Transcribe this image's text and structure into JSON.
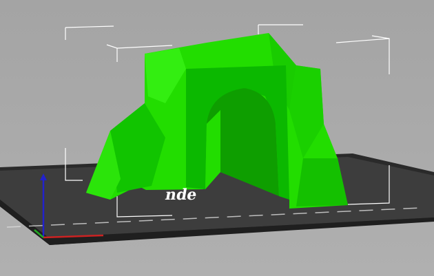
{
  "viewport": {
    "background_color": "#a8a8a8",
    "bed_color": "#3a3a3a",
    "model_color": "#22dd00",
    "bed_logo_partial": "nde",
    "axes": {
      "x_color": "#cc2222",
      "y_color": "#22aa22",
      "z_color": "#2222cc"
    }
  }
}
